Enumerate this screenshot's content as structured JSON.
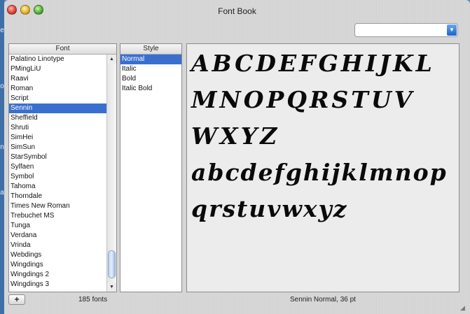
{
  "window": {
    "title": "Font Book"
  },
  "desktop": {
    "edge_chars": [
      "e",
      "o",
      "n",
      "a"
    ]
  },
  "search": {
    "value": "",
    "placeholder": ""
  },
  "font_list": {
    "header": "Font",
    "selected_index": 5,
    "items": [
      "Palatino Linotype",
      "PMingLiU",
      "Raavi",
      "Roman",
      "Script",
      "Sennin",
      "Sheffield",
      "Shruti",
      "SimHei",
      "SimSun",
      "StarSymbol",
      "Sylfaen",
      "Symbol",
      "Tahoma",
      "Thorndale",
      "Times New Roman",
      "Trebuchet MS",
      "Tunga",
      "Verdana",
      "Vrinda",
      "Webdings",
      "Wingdings",
      "Wingdings 2",
      "Wingdings 3"
    ]
  },
  "style_list": {
    "header": "Style",
    "selected_index": 0,
    "items": [
      "Normal",
      "Italic",
      "Bold",
      "Italic Bold"
    ]
  },
  "preview": {
    "lines": [
      "ABCDEFGHIJKL",
      "MNOPQRSTUV",
      "WXYZ",
      "abcdefghijklmnop",
      "qrstuvwxyz"
    ]
  },
  "footer": {
    "add_label": "+",
    "count_text": "185 fonts",
    "status_text": "Sennin Normal, 36 pt"
  },
  "icons": {
    "close": "close-icon",
    "minimize": "minimize-icon",
    "zoom": "zoom-icon",
    "dropdown": "chevron-down-icon",
    "scroll_up": "arrow-up-icon",
    "scroll_down": "arrow-down-icon"
  },
  "colors": {
    "selection": "#3a6fcf",
    "close": "#e0463a",
    "minimize": "#e9b42c",
    "zoom": "#52b33a"
  }
}
